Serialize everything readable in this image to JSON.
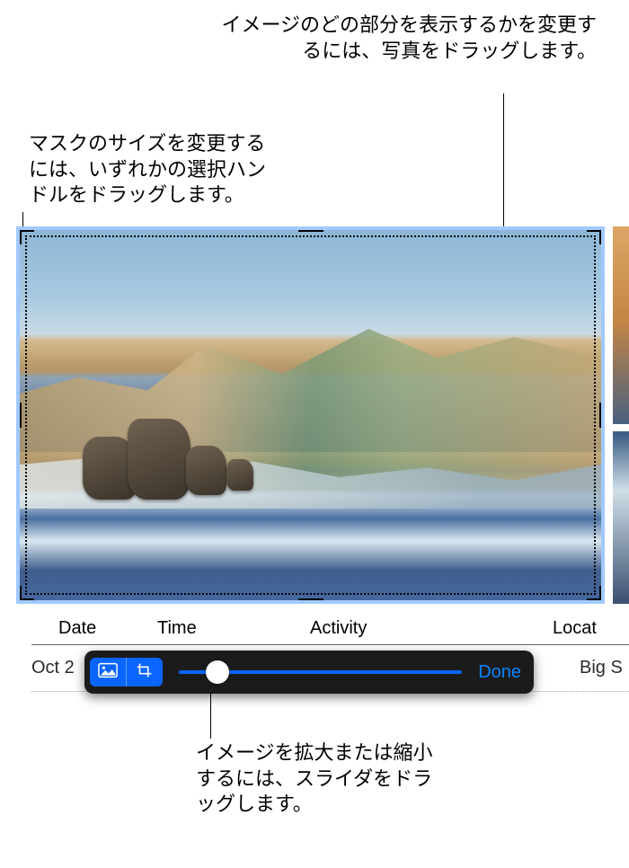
{
  "callouts": {
    "drag_photo": "イメージのどの部分を表示するかを変更するには、写真をドラッグします。",
    "mask_resize": "マスクのサイズを変更するには、いずれかの選択ハンドルをドラッグします。",
    "zoom_slider": "イメージを拡大または縮小するには、スライダをドラッグします。"
  },
  "table": {
    "headers": {
      "date": "Date",
      "time": "Time",
      "activity": "Activity",
      "location": "Locat"
    },
    "row1": {
      "date": "Oct 2",
      "location": "Big S"
    }
  },
  "toolbar": {
    "done_label": "Done"
  }
}
